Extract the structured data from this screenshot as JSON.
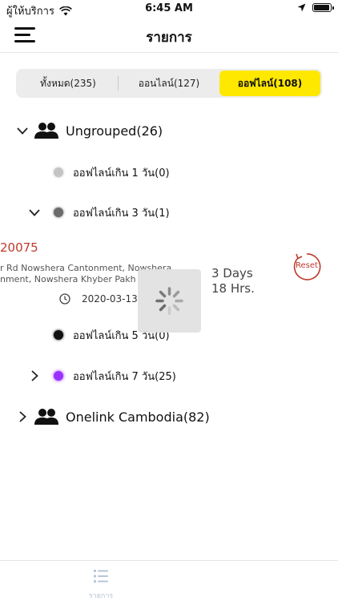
{
  "status_bar": {
    "carrier": "ผู้ให้บริการ",
    "time": "6:45 AM"
  },
  "nav": {
    "title": "รายการ",
    "menu_icon": "hamburger-icon"
  },
  "segments": [
    {
      "label": "ทั้งหมด(235)",
      "active": false
    },
    {
      "label": "ออนไลน์(127)",
      "active": false
    },
    {
      "label": "ออฟไลน์(108)",
      "active": true
    }
  ],
  "groups": [
    {
      "label": "Ungrouped(26)",
      "expanded": true,
      "icon": "people-icon"
    },
    {
      "label": "Onelink Cambodia(82)",
      "expanded": false,
      "icon": "people-icon"
    }
  ],
  "subgroups": [
    {
      "label": "ออฟไลน์เกิน 1 วัน(0)",
      "color": "#c4c4c4",
      "chevron": "none"
    },
    {
      "label": "ออฟไลน์เกิน 3 วัน(1)",
      "color": "#6b6b6b",
      "chevron": "down"
    },
    {
      "label": "ออฟไลน์เกิน 5 วัน(0)",
      "color": "#111111",
      "chevron": "none"
    },
    {
      "label": "ออฟไลน์เกิน 7 วัน(25)",
      "color": "#9b30ff",
      "chevron": "right"
    }
  ],
  "device": {
    "id": "20075",
    "address_line1": "r Rd Nowshera Cantonment, Nowshera",
    "address_line2": "nment, Nowshera Khyber Pakh",
    "time": "2020-03-13",
    "duration_line1": "3 Days",
    "duration_line2": "18 Hrs.",
    "reset_label": "Reset"
  },
  "tab_bar": {
    "list_label": "รายการ"
  },
  "colors": {
    "accent_yellow": "#ffe800",
    "alert_red": "#c0392b",
    "tab_inactive": "#b8c4d8"
  }
}
